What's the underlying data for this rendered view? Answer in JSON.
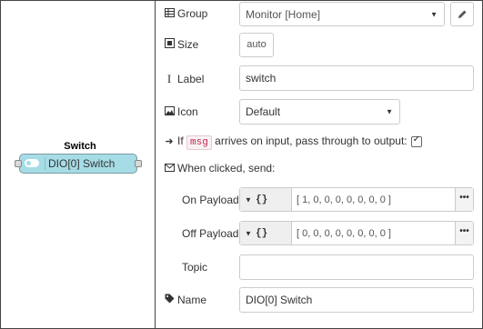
{
  "node": {
    "title": "Switch",
    "label": "DIO[0] Switch",
    "color": "#a6dce6"
  },
  "form": {
    "group": {
      "label": "Group",
      "icon": "table-icon",
      "value": "Monitor [Home]",
      "edit_icon": "pencil-icon"
    },
    "size": {
      "label": "Size",
      "icon": "resize-icon",
      "value": "auto"
    },
    "label": {
      "label": "Label",
      "icon": "text-cursor-icon",
      "value": "switch"
    },
    "icon": {
      "label": "Icon",
      "icon": "image-icon",
      "value": "Default"
    },
    "passthrough": {
      "prefix": "If",
      "code": "msg",
      "suffix": "arrives on input, pass through to output:",
      "checked": true
    },
    "when_clicked": {
      "label": "When clicked, send:",
      "icon": "envelope-icon"
    },
    "on_payload": {
      "label": "On Payload",
      "type": "{}",
      "value": "[ 1, 0, 0, 0, 0, 0, 0, 0 ]"
    },
    "off_payload": {
      "label": "Off Payload",
      "type": "{}",
      "value": "[ 0, 0, 0, 0, 0, 0, 0, 0 ]"
    },
    "topic": {
      "label": "Topic",
      "value": ""
    },
    "name": {
      "label": "Name",
      "icon": "tag-icon",
      "value": "DIO[0] Switch"
    }
  },
  "symbols": {
    "dots": "•••"
  },
  "colors": {
    "msg_code": "#c7254e",
    "border": "#cccccc"
  }
}
